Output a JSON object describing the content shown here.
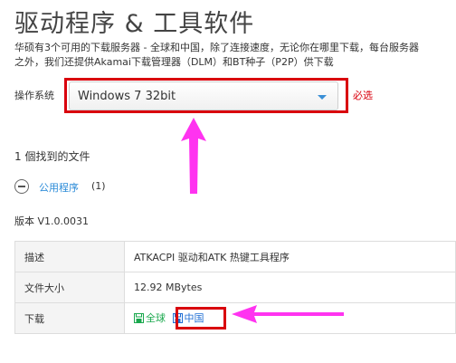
{
  "page": {
    "title": "驱动程序 & 工具软件",
    "description_lines": [
      "华硕有3个可用的下载服务器 - 全球和中国，除了连接速度，无论你在哪里下载，每台服务器",
      "之外，我们还提供Akamai下载管理器（DLM）和BT种子（P2P）供下载"
    ]
  },
  "os_selector": {
    "label": "操作系统",
    "selected": "Windows 7 32bit",
    "required_text": "必选"
  },
  "results": {
    "found_text": "1 個找到的文件",
    "category": {
      "label": "公用程序",
      "count": "(1)",
      "icon": "minus-circle-icon"
    },
    "version_text": "版本 V1.0.0031"
  },
  "file_table": {
    "rows": [
      {
        "label": "描述",
        "value": "ATKACPI 驱动和ATK 热键工具程序"
      },
      {
        "label": "文件大小",
        "value": "12.92 MBytes"
      },
      {
        "label": "下载"
      }
    ],
    "download_links": [
      {
        "label": "全球",
        "icon": "save-icon",
        "color": "#1aa84d"
      },
      {
        "label": "中国",
        "icon": "save-icon",
        "color": "#1f6ed4"
      }
    ]
  },
  "colors": {
    "highlight_red": "#d9000d",
    "arrow_magenta": "#ff33f0",
    "link_blue": "#2b8bd8"
  }
}
